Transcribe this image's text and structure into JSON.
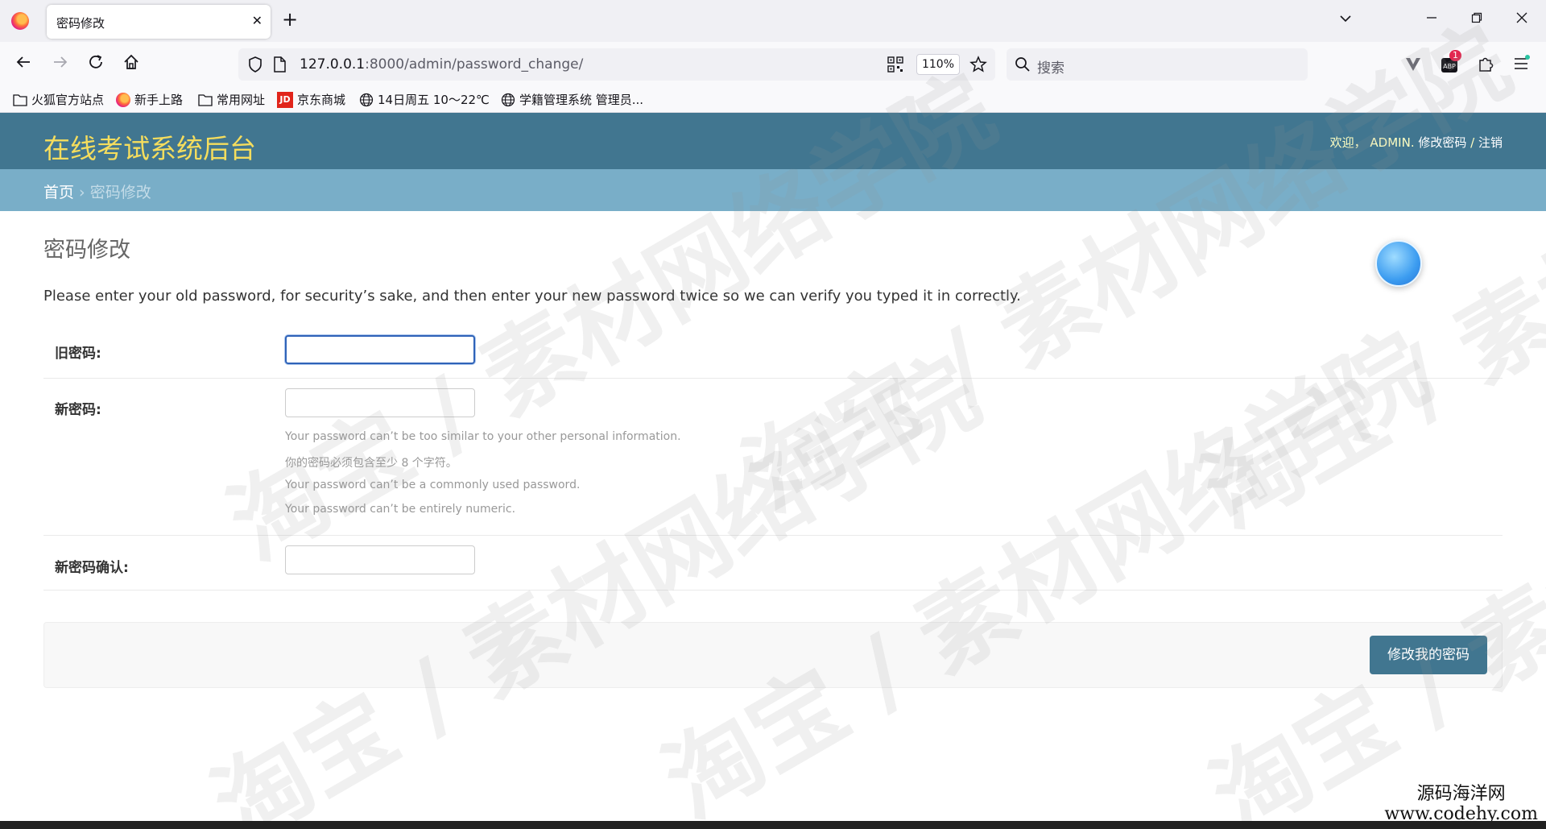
{
  "browser": {
    "tab_title": "密码修改",
    "tab_close": "✕",
    "new_tab": "+",
    "url_host": "127.0.0.1",
    "url_rest": ":8000/admin/password_change/",
    "zoom": "110%",
    "search_placeholder": "搜索",
    "extension_badge": "1",
    "bookmarks": [
      "火狐官方站点",
      "新手上路",
      "常用网址",
      "京东商城",
      "14日周五  10～22℃",
      "学籍管理系统 管理员..."
    ],
    "bookmark_jd_logo": "JD"
  },
  "admin": {
    "site_title": "在线考试系统后台",
    "user_tools": {
      "welcome": "欢迎，",
      "username": "ADMIN",
      "sep1": ".",
      "change_password": "修改密码",
      "sep2": " / ",
      "logout": "注销"
    },
    "breadcrumbs": {
      "home": "首页",
      "sep": " › ",
      "current": "密码修改"
    },
    "page_title": "密码修改",
    "intro": "Please enter your old password, for security’s sake, and then enter your new password twice so we can verify you typed it in correctly.",
    "fields": {
      "old_password": {
        "label": "旧密码:",
        "value": ""
      },
      "new_password": {
        "label": "新密码:",
        "value": "",
        "help": [
          "Your password can’t be too similar to your other personal information.",
          "你的密码必须包含至少 8 个字符。",
          "Your password can’t be a commonly used password.",
          "Your password can’t be entirely numeric."
        ]
      },
      "confirm_password": {
        "label": "新密码确认:",
        "value": ""
      }
    },
    "submit_label": "修改我的密码"
  },
  "overlay": {
    "watermark": "淘宝 / 素材网络学院",
    "corner_line1": "源码海洋网",
    "corner_line2": "www.codehy.com"
  }
}
